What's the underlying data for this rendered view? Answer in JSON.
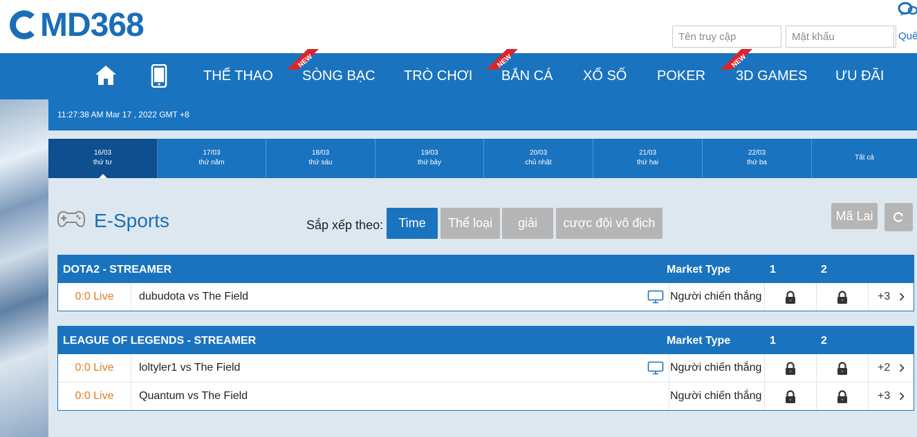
{
  "header": {
    "logo": "MD368",
    "username_placeholder": "Tên truy cập",
    "password_placeholder": "Mật khẩu",
    "forgot_label": "Quên"
  },
  "nav": {
    "items": [
      {
        "label": "THỂ THAO",
        "new": false
      },
      {
        "label": "SÒNG BẠC",
        "new": true
      },
      {
        "label": "TRÒ CHƠI",
        "new": false
      },
      {
        "label": "BẮN CÁ",
        "new": true
      },
      {
        "label": "XỔ SỐ",
        "new": false
      },
      {
        "label": "POKER",
        "new": false
      },
      {
        "label": "3D GAMES",
        "new": true
      },
      {
        "label": "ƯU ĐÃI",
        "new": false
      }
    ],
    "new_badge": "NEW"
  },
  "clock": "11:27:38 AM Mar 17 , 2022 GMT +8",
  "dates": [
    {
      "date": "16/03",
      "weekday": "thứ tư",
      "active": true
    },
    {
      "date": "17/03",
      "weekday": "thứ năm"
    },
    {
      "date": "18/03",
      "weekday": "thứ sáu"
    },
    {
      "date": "19/03",
      "weekday": "thứ bảy"
    },
    {
      "date": "20/03",
      "weekday": "chủ nhật"
    },
    {
      "date": "21/03",
      "weekday": "thứ hai"
    },
    {
      "date": "22/03",
      "weekday": "thứ ba"
    },
    {
      "date": "Tất cả",
      "weekday": ""
    }
  ],
  "section": {
    "title": "E-Sports",
    "sort_label": "Sắp xếp theo:",
    "sort_options": [
      "Time",
      "Thể loại",
      "giải",
      "cược đội vô địch"
    ],
    "active_sort": "Time",
    "malai_label": "Mã Lai"
  },
  "leagues": [
    {
      "name": "DOTA2 - STREAMER",
      "market_header": "Market Type",
      "col1": "1",
      "col2": "2",
      "matches": [
        {
          "status": "0:0 Live",
          "teams": "dubudota vs The Field",
          "stream": true,
          "market": "Người chiến thắng",
          "more": "+3"
        }
      ]
    },
    {
      "name": "LEAGUE OF LEGENDS - STREAMER",
      "market_header": "Market Type",
      "col1": "1",
      "col2": "2",
      "matches": [
        {
          "status": "0:0 Live",
          "teams": "loltyler1 vs The Field",
          "stream": true,
          "market": "Người chiến thắng",
          "more": "+2"
        },
        {
          "status": "0:0 Live",
          "teams": "Quantum vs The Field",
          "stream": false,
          "market": "Người chiến thắng",
          "more": "+3"
        }
      ]
    }
  ],
  "colors": {
    "brand_blue": "#1a73bf",
    "live_orange": "#e07b1f",
    "new_red": "#d9262c"
  }
}
